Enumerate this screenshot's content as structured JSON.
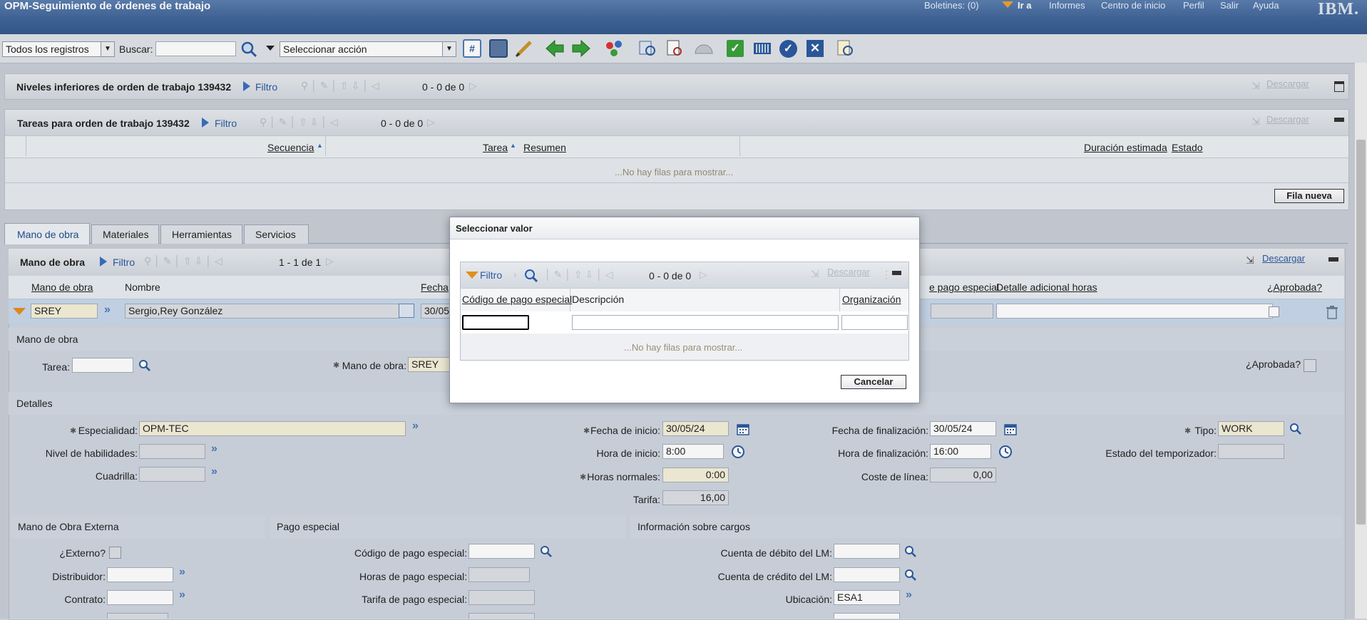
{
  "header": {
    "app_title": "OPM-Seguimiento de órdenes de trabajo",
    "links": [
      "Boletines: (0)",
      "Ir a",
      "Informes",
      "Centro de inicio",
      "Perfil",
      "Salir",
      "Ayuda"
    ],
    "logo": "IBM."
  },
  "toolbar": {
    "query_select": "Todos los registros",
    "search_label": "Buscar:",
    "search_value": "",
    "action_select": "Seleccionar acción"
  },
  "children_section": {
    "title": "Niveles inferiores de orden de trabajo 139432",
    "filter": "Filtro",
    "count": "0 - 0 de 0",
    "download": "Descargar"
  },
  "tasks_section": {
    "title": "Tareas para orden de trabajo 139432",
    "filter": "Filtro",
    "count": "0 - 0 de 0",
    "download": "Descargar",
    "columns": [
      "Secuencia",
      "Tarea",
      "Resumen",
      "Duración estimada",
      "Estado"
    ],
    "empty": "...No hay filas para mostrar...",
    "new_row": "Fila nueva"
  },
  "tabs": [
    "Mano de obra",
    "Materiales",
    "Herramientas",
    "Servicios"
  ],
  "labor_table": {
    "title": "Mano de obra",
    "filter": "Filtro",
    "count": "1 - 1 de 1",
    "download": "Descargar",
    "columns": [
      "Mano de obra",
      "Nombre",
      "Fecha",
      "e pago especial",
      "Detalle adicional horas",
      "¿Aprobada?"
    ],
    "row": {
      "labor": "SREY",
      "name": "Sergio,Rey González",
      "date": "30/05/"
    }
  },
  "labor_detail": {
    "group_title": "Mano de obra",
    "task_label": "Tarea:",
    "task_value": "",
    "labor_label": "Mano de obra:",
    "labor_value": "SREY",
    "approved_label": "¿Aprobada?"
  },
  "details": {
    "title": "Detalles",
    "craft_label": "Especialidad:",
    "craft_value": "OPM-TEC",
    "skill_label": "Nivel de habilidades:",
    "skill_value": "",
    "crew_label": "Cuadrilla:",
    "crew_value": "",
    "start_date_label": "Fecha de inicio:",
    "start_date_value": "30/05/24",
    "start_time_label": "Hora de inicio:",
    "start_time_value": "8:00",
    "reg_hours_label": "Horas normales:",
    "reg_hours_value": "0:00",
    "rate_label": "Tarifa:",
    "rate_value": "16,00",
    "end_date_label": "Fecha de finalización:",
    "end_date_value": "30/05/24",
    "end_time_label": "Hora de finalización:",
    "end_time_value": "16:00",
    "line_cost_label": "Coste de línea:",
    "line_cost_value": "0,00",
    "type_label": "Tipo:",
    "type_value": "WORK",
    "timer_label": "Estado del temporizador:",
    "timer_value": ""
  },
  "external": {
    "title": "Mano de Obra Externa",
    "external_label": "¿Externo?",
    "vendor_label": "Distribuidor:",
    "vendor_value": "",
    "contract_label": "Contrato:",
    "contract_value": ""
  },
  "premium": {
    "title": "Pago especial",
    "code_label": "Código de pago especial:",
    "code_value": "",
    "hours_label": "Horas de pago especial:",
    "hours_value": "",
    "rate_label": "Tarifa de pago especial:",
    "rate_value": ""
  },
  "charges": {
    "title": "Información sobre cargos",
    "debit_label": "Cuenta de débito del LM:",
    "debit_value": "",
    "credit_label": "Cuenta de crédito del LM:",
    "credit_value": "",
    "location_label": "Ubicación:",
    "location_value": "ESA1"
  },
  "dialog": {
    "title": "Seleccionar valor",
    "filter": "Filtro",
    "count": "0 - 0 de 0",
    "download": "Descargar",
    "columns": [
      "Código de pago especial",
      "Descripción",
      "Organización"
    ],
    "empty": "...No hay filas para mostrar...",
    "cancel": "Cancelar"
  }
}
